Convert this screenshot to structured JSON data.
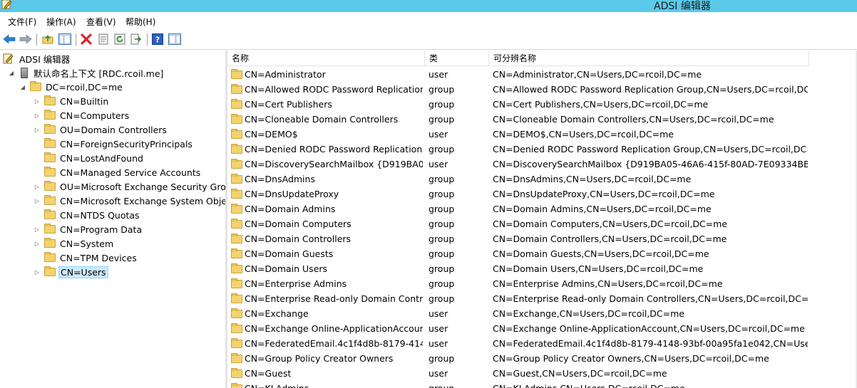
{
  "window": {
    "title": "ADSI 编辑器",
    "colors": {
      "titlebar": "#5bc9ea",
      "selection": "#cde8ff",
      "folder": "#f3d36e"
    }
  },
  "menu": [
    "文件(F)",
    "操作(A)",
    "查看(V)",
    "帮助(H)"
  ],
  "toolbar": {
    "icons": [
      "back-arrow-icon",
      "forward-arrow-icon",
      "up-folder-icon",
      "show-hide-tree-icon",
      "delete-icon",
      "properties-icon",
      "refresh-icon",
      "export-list-icon",
      "help-icon",
      "action-pane-icon"
    ]
  },
  "tree": {
    "root": "ADSI 编辑器",
    "connection": "默认命名上下文 [RDC.rcoil.me]",
    "domain": "DC=rcoil,DC=me",
    "children": [
      {
        "label": "CN=Builtin",
        "expandable": true
      },
      {
        "label": "CN=Computers",
        "expandable": true
      },
      {
        "label": "OU=Domain Controllers",
        "expandable": true
      },
      {
        "label": "CN=ForeignSecurityPrincipals",
        "expandable": false
      },
      {
        "label": "CN=LostAndFound",
        "expandable": false
      },
      {
        "label": "CN=Managed Service Accounts",
        "expandable": false
      },
      {
        "label": "OU=Microsoft Exchange Security Group",
        "expandable": true
      },
      {
        "label": "CN=Microsoft Exchange System Object",
        "expandable": true
      },
      {
        "label": "CN=NTDS Quotas",
        "expandable": false
      },
      {
        "label": "CN=Program Data",
        "expandable": true
      },
      {
        "label": "CN=System",
        "expandable": true
      },
      {
        "label": "CN=TPM Devices",
        "expandable": false
      },
      {
        "label": "CN=Users",
        "expandable": true,
        "selected": true
      }
    ]
  },
  "list": {
    "columns": [
      "名称",
      "类",
      "可分辨名称"
    ],
    "rows": [
      {
        "name": "CN=Administrator",
        "class": "user",
        "dn": "CN=Administrator,CN=Users,DC=rcoil,DC=me"
      },
      {
        "name": "CN=Allowed RODC Password Replication...",
        "class": "group",
        "dn": "CN=Allowed RODC Password Replication Group,CN=Users,DC=rcoil,DC=..."
      },
      {
        "name": "CN=Cert Publishers",
        "class": "group",
        "dn": "CN=Cert Publishers,CN=Users,DC=rcoil,DC=me"
      },
      {
        "name": "CN=Cloneable Domain Controllers",
        "class": "group",
        "dn": "CN=Cloneable Domain Controllers,CN=Users,DC=rcoil,DC=me"
      },
      {
        "name": "CN=DEMO$",
        "class": "user",
        "dn": "CN=DEMO$,CN=Users,DC=rcoil,DC=me"
      },
      {
        "name": "CN=Denied RODC Password Replication ...",
        "class": "group",
        "dn": "CN=Denied RODC Password Replication Group,CN=Users,DC=rcoil,DC=..."
      },
      {
        "name": "CN=DiscoverySearchMailbox {D919BA05...",
        "class": "user",
        "dn": "CN=DiscoverySearchMailbox {D919BA05-46A6-415f-80AD-7E09334BB852..."
      },
      {
        "name": "CN=DnsAdmins",
        "class": "group",
        "dn": "CN=DnsAdmins,CN=Users,DC=rcoil,DC=me"
      },
      {
        "name": "CN=DnsUpdateProxy",
        "class": "group",
        "dn": "CN=DnsUpdateProxy,CN=Users,DC=rcoil,DC=me"
      },
      {
        "name": "CN=Domain Admins",
        "class": "group",
        "dn": "CN=Domain Admins,CN=Users,DC=rcoil,DC=me"
      },
      {
        "name": "CN=Domain Computers",
        "class": "group",
        "dn": "CN=Domain Computers,CN=Users,DC=rcoil,DC=me"
      },
      {
        "name": "CN=Domain Controllers",
        "class": "group",
        "dn": "CN=Domain Controllers,CN=Users,DC=rcoil,DC=me"
      },
      {
        "name": "CN=Domain Guests",
        "class": "group",
        "dn": "CN=Domain Guests,CN=Users,DC=rcoil,DC=me"
      },
      {
        "name": "CN=Domain Users",
        "class": "group",
        "dn": "CN=Domain Users,CN=Users,DC=rcoil,DC=me"
      },
      {
        "name": "CN=Enterprise Admins",
        "class": "group",
        "dn": "CN=Enterprise Admins,CN=Users,DC=rcoil,DC=me"
      },
      {
        "name": "CN=Enterprise Read-only Domain Contr...",
        "class": "group",
        "dn": "CN=Enterprise Read-only Domain Controllers,CN=Users,DC=rcoil,DC=me"
      },
      {
        "name": "CN=Exchange",
        "class": "user",
        "dn": "CN=Exchange,CN=Users,DC=rcoil,DC=me"
      },
      {
        "name": "CN=Exchange Online-ApplicationAccount",
        "class": "user",
        "dn": "CN=Exchange Online-ApplicationAccount,CN=Users,DC=rcoil,DC=me"
      },
      {
        "name": "CN=FederatedEmail.4c1f4d8b-8179-4148...",
        "class": "user",
        "dn": "CN=FederatedEmail.4c1f4d8b-8179-4148-93bf-00a95fa1e042,CN=Users,..."
      },
      {
        "name": "CN=Group Policy Creator Owners",
        "class": "group",
        "dn": "CN=Group Policy Creator Owners,CN=Users,DC=rcoil,DC=me"
      },
      {
        "name": "CN=Guest",
        "class": "user",
        "dn": "CN=Guest,CN=Users,DC=rcoil,DC=me"
      },
      {
        "name": "CN=KLAdmins",
        "class": "group",
        "dn": "CN=KLAdmins,CN=Users,DC=rcoil,DC=me"
      }
    ]
  }
}
